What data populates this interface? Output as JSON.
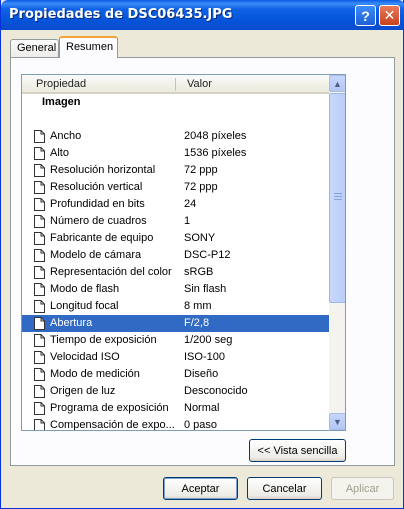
{
  "window": {
    "title": "Propiedades de DSC06435.JPG"
  },
  "titlebar_buttons": {
    "help": "?",
    "close": "✕"
  },
  "tabs": [
    {
      "label": "General"
    },
    {
      "label": "Resumen"
    }
  ],
  "list": {
    "columns": {
      "property": "Propiedad",
      "value": "Valor"
    },
    "group": "Imagen",
    "rows": [
      {
        "name": "Ancho",
        "value": "2048 píxeles"
      },
      {
        "name": "Alto",
        "value": "1536 píxeles"
      },
      {
        "name": "Resolución horizontal",
        "value": "72 ppp"
      },
      {
        "name": "Resolución vertical",
        "value": "72 ppp"
      },
      {
        "name": "Profundidad en bits",
        "value": "24"
      },
      {
        "name": "Número de cuadros",
        "value": "1"
      },
      {
        "name": "Fabricante de equipo",
        "value": "SONY"
      },
      {
        "name": "Modelo de cámara",
        "value": "DSC-P12"
      },
      {
        "name": "Representación del color",
        "value": "sRGB"
      },
      {
        "name": "Modo de flash",
        "value": "Sin flash"
      },
      {
        "name": "Longitud focal",
        "value": "8 mm"
      },
      {
        "name": "Abertura",
        "value": "F/2,8",
        "selected": true
      },
      {
        "name": "Tiempo de exposición",
        "value": "1/200 seg"
      },
      {
        "name": "Velocidad ISO",
        "value": "ISO-100"
      },
      {
        "name": "Modo de medición",
        "value": "Diseño"
      },
      {
        "name": "Origen de luz",
        "value": "Desconocido"
      },
      {
        "name": "Programa de exposición",
        "value": "Normal"
      },
      {
        "name": "Compensación de expo...",
        "value": "0 paso"
      }
    ]
  },
  "buttons": {
    "simple_view": "<< Vista sencilla",
    "ok": "Aceptar",
    "cancel": "Cancelar",
    "apply": "Aplicar"
  },
  "colors": {
    "title_bar": "#0553d9",
    "selection": "#316ac5",
    "window_bg": "#ece9d8",
    "active_tab_accent": "#f1a239"
  }
}
